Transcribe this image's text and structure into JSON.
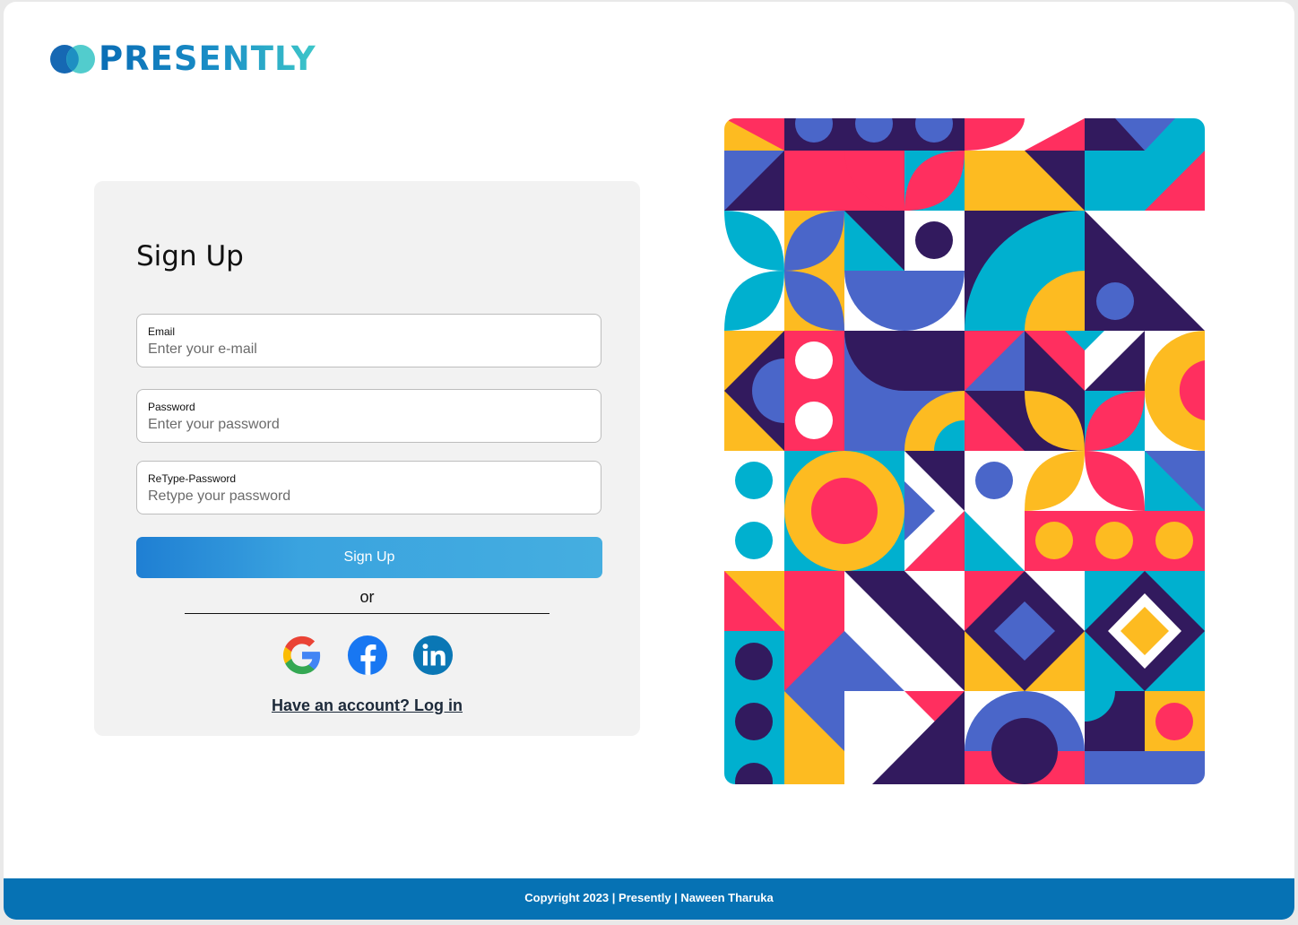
{
  "brand": {
    "name": "PRESENTLY"
  },
  "signup": {
    "title": "Sign Up",
    "email": {
      "label": "Email",
      "placeholder": "Enter your e-mail"
    },
    "password": {
      "label": "Password",
      "placeholder": "Enter your password"
    },
    "retype": {
      "label": "ReType-Password",
      "placeholder": "Retype your password"
    },
    "submit_label": "Sign Up",
    "or_text": "or",
    "social": [
      "google-icon",
      "facebook-icon",
      "linkedin-icon"
    ],
    "login_link": "Have an account? Log in"
  },
  "colors": {
    "accent": "#0672b4",
    "button_start": "#1f7fd3",
    "button_end": "#45aee0",
    "art_palette": [
      "#fdbb21",
      "#ff2f5f",
      "#321a5e",
      "#00b0cf",
      "#4a66c9",
      "#ffffff"
    ]
  },
  "footer": {
    "text": "Copyright 2023 | Presently | Naween Tharuka"
  }
}
